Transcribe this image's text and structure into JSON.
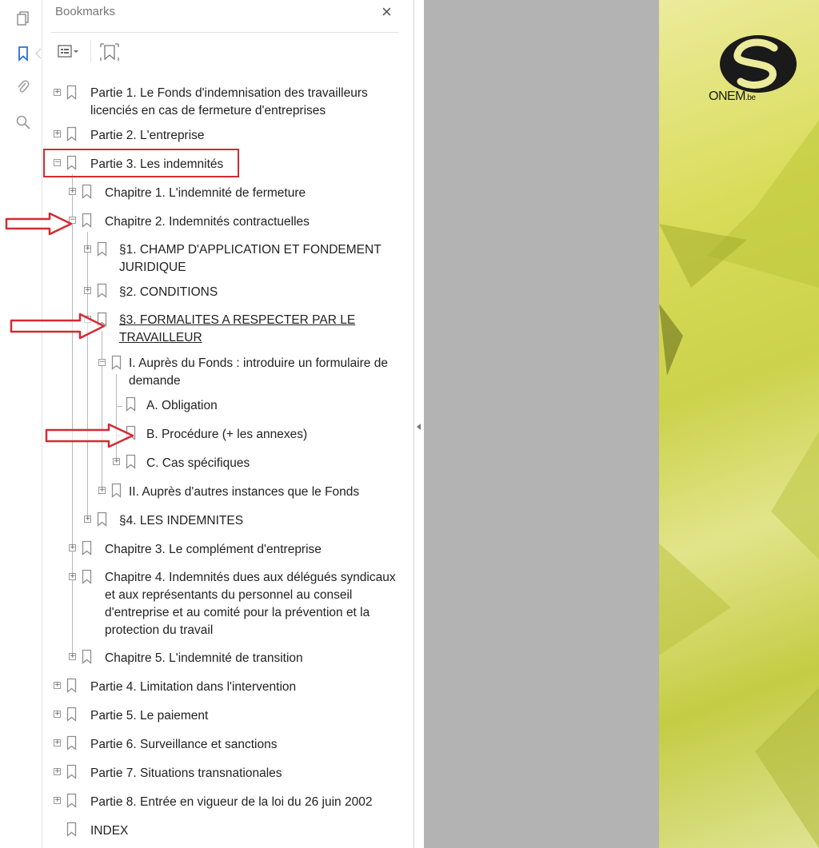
{
  "panel": {
    "title": "Bookmarks",
    "close_glyph": "×"
  },
  "toolstrip": {
    "icons": [
      "page-thumbnails-icon",
      "bookmarks-icon",
      "attachments-icon",
      "search-icon"
    ]
  },
  "toolbar": {
    "options_icon": "bookmark-options-icon",
    "tag_icon": "new-bookmark-from-structure-icon"
  },
  "bookmarks": [
    {
      "label": "Partie 1. Le Fonds d'indemnisation des travailleurs licenciés en cas de fermeture d'entreprises"
    },
    {
      "label": "Partie 2. L'entreprise"
    },
    {
      "label": "Partie 3. Les indemnités"
    },
    {
      "label": "Chapitre 1. L'indemnité de fermeture"
    },
    {
      "label": "Chapitre 2. Indemnités contractuelles"
    },
    {
      "label": "§1. CHAMP D'APPLICATION ET FONDEMENT JURIDIQUE"
    },
    {
      "label": "§2. CONDITIONS"
    },
    {
      "label": "§3. FORMALITES A RESPECTER PAR LE TRAVAILLEUR"
    },
    {
      "label": "I. Auprès du Fonds : introduire un formulaire de demande"
    },
    {
      "label": "A. Obligation"
    },
    {
      "label": "B. Procédure (+ les annexes)"
    },
    {
      "label": "C. Cas spécifiques"
    },
    {
      "label": "II. Auprès d'autres instances que le Fonds"
    },
    {
      "label": "§4. LES INDEMNITES"
    },
    {
      "label": "Chapitre 3. Le complément d'entreprise"
    },
    {
      "label": "Chapitre 4. Indemnités dues aux délégués syndicaux et aux représentants du personnel au conseil d'entreprise et au comité pour la prévention et la protection du travail"
    },
    {
      "label": "Chapitre 5. L'indemnité de transition"
    },
    {
      "label": "Partie 4. Limitation dans l'intervention"
    },
    {
      "label": "Partie 5. Le paiement"
    },
    {
      "label": "Partie 6. Surveillance et sanctions"
    },
    {
      "label": "Partie 7. Situations transnationales"
    },
    {
      "label": "Partie 8. Entrée en vigueur de la loi du 26 juin 2002"
    },
    {
      "label": "INDEX"
    }
  ],
  "document": {
    "logo_text": "ONEM",
    "logo_suffix": ".be"
  },
  "colors": {
    "highlight": "#d42a34",
    "accent_blue": "#2a6fdb",
    "gray_area": "#b3b3b3"
  }
}
